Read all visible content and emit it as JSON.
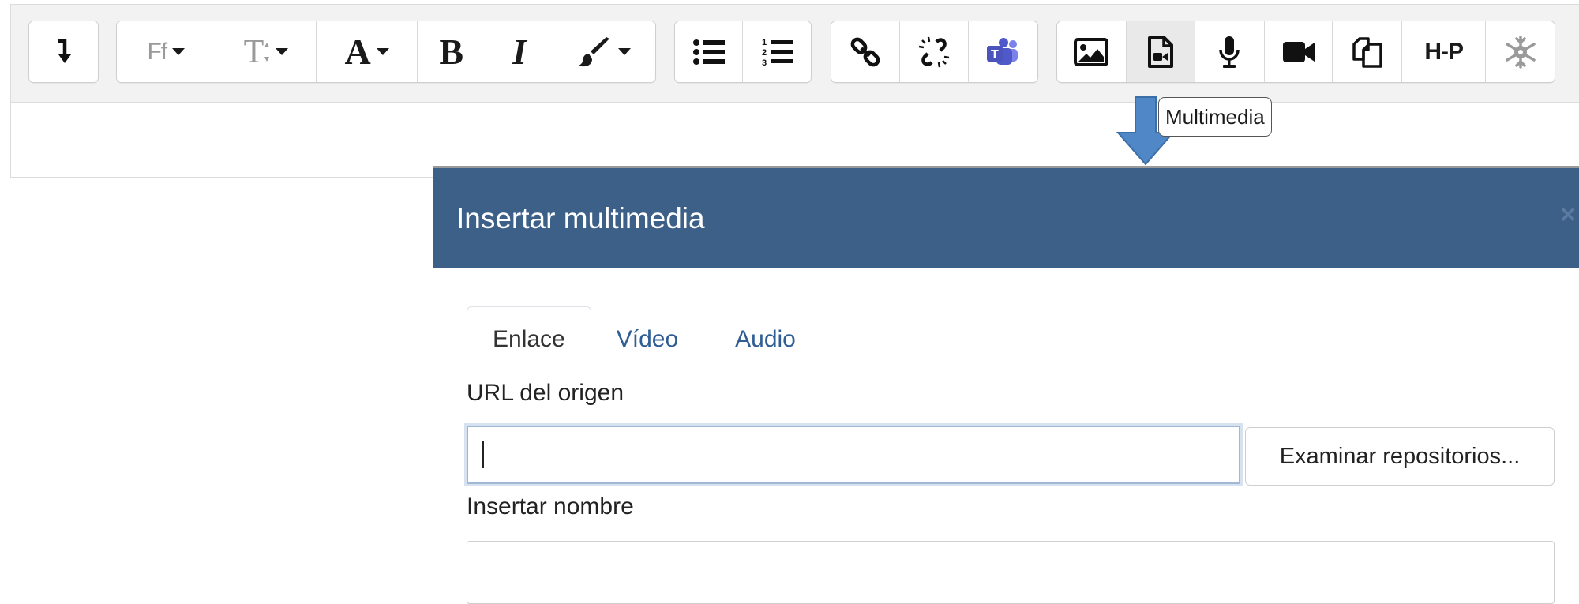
{
  "toolbar": {
    "tooltip": "Multimedia",
    "buttons": {
      "font_family": "Ff",
      "font_size": "T",
      "font_color": "A",
      "bold": "B",
      "italic": "I",
      "h5p": "H-P"
    },
    "icons": [
      "collapse-toolbar-icon",
      "font-family-icon",
      "font-size-icon",
      "font-color-icon",
      "bold-icon",
      "italic-icon",
      "background-color-brush-icon",
      "unordered-list-icon",
      "ordered-list-icon",
      "link-icon",
      "unlink-icon",
      "teams-icon",
      "image-icon",
      "media-icon",
      "record-audio-icon",
      "record-video-icon",
      "manage-files-icon",
      "h5p-icon",
      "accessibility-checker-icon"
    ],
    "active_button": "media"
  },
  "dialog": {
    "title": "Insertar multimedia",
    "close_glyph": "×",
    "tabs": [
      {
        "label": "Enlace",
        "active": true
      },
      {
        "label": "Vídeo",
        "active": false
      },
      {
        "label": "Audio",
        "active": false
      }
    ],
    "url_label": "URL del origen",
    "url_value": "",
    "browse_button": "Examinar repositorios...",
    "name_label": "Insertar nombre",
    "name_value": ""
  },
  "colors": {
    "dialog_header": "#3d6089",
    "tab_link": "#2f5e95",
    "arrow": "#4f87c7"
  }
}
